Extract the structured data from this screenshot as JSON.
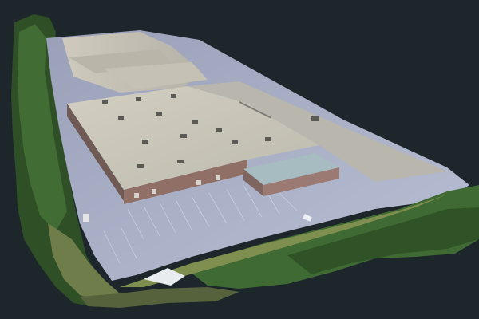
{
  "scene": {
    "subject": "aerial-3d-reconstruction-warehouse",
    "colors": {
      "background": "#1d262a",
      "roof_light": "#c9c6ba",
      "roof_shadow": "#a9a79d",
      "parking_lot": "#a7adc4",
      "wall": "#8f6f66",
      "annex_roof": "#9fb3b7",
      "vegetation": "#3f6a33",
      "vegetation_dark": "#2f4f27",
      "grass": "#6f8a4a"
    }
  }
}
